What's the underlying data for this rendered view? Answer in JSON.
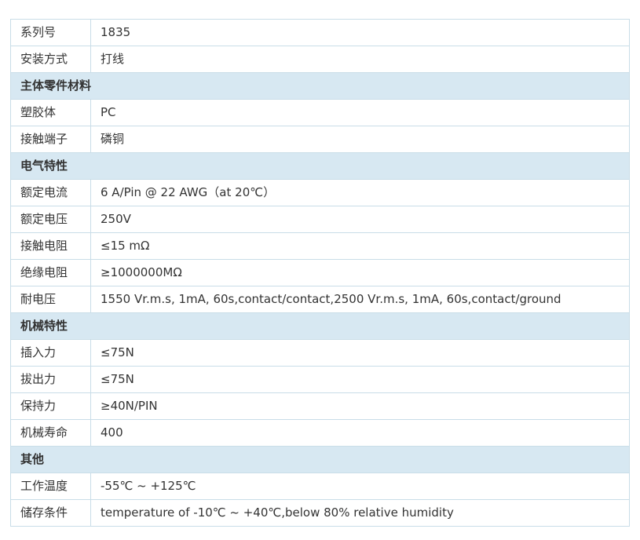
{
  "rows": [
    {
      "type": "row",
      "label": "系列号",
      "value": "1835"
    },
    {
      "type": "row",
      "label": "安装方式",
      "value": "打线"
    },
    {
      "type": "section",
      "title": "主体零件材料"
    },
    {
      "type": "row",
      "label": "塑胶体",
      "value": "PC"
    },
    {
      "type": "row",
      "label": "接触端子",
      "value": "磷铜"
    },
    {
      "type": "section",
      "title": "电气特性"
    },
    {
      "type": "row",
      "label": "额定电流",
      "value": "6 A/Pin @ 22 AWG（at 20℃）"
    },
    {
      "type": "row",
      "label": "额定电压",
      "value": "250V"
    },
    {
      "type": "row",
      "label": "接触电阻",
      "value": "≤15 mΩ"
    },
    {
      "type": "row",
      "label": "绝缘电阻",
      "value": "≥1000000MΩ"
    },
    {
      "type": "row",
      "label": "耐电压",
      "value": "1550 Vr.m.s, 1mA, 60s,contact/contact,2500 Vr.m.s, 1mA, 60s,contact/ground"
    },
    {
      "type": "section",
      "title": "机械特性"
    },
    {
      "type": "row",
      "label": "插入力",
      "value": "≤75N"
    },
    {
      "type": "row",
      "label": "拔出力",
      "value": "≤75N"
    },
    {
      "type": "row",
      "label": "保持力",
      "value": "≥40N/PIN"
    },
    {
      "type": "row",
      "label": "机械寿命",
      "value": "400"
    },
    {
      "type": "section",
      "title": "其他"
    },
    {
      "type": "row",
      "label": "工作温度",
      "value": "-55℃ ~ +125℃"
    },
    {
      "type": "row",
      "label": "储存条件",
      "value": "temperature of -10℃ ~ +40℃,below 80% relative humidity"
    }
  ],
  "colors": {
    "border": "#c9dde8",
    "section_bg": "#d7e8f2",
    "text": "#333333"
  }
}
